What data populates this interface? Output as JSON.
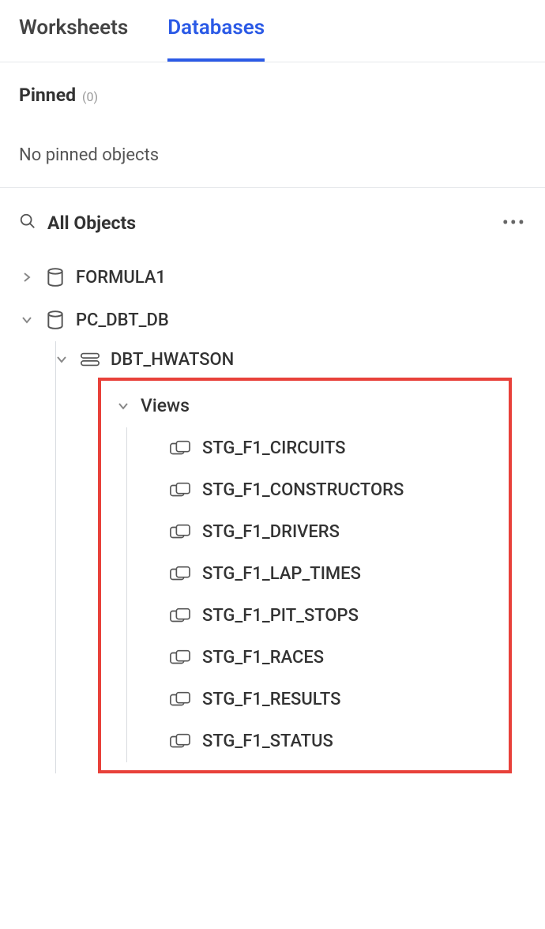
{
  "tabs": {
    "worksheets": "Worksheets",
    "databases": "Databases"
  },
  "pinned": {
    "title": "Pinned",
    "count": "(0)",
    "empty": "No pinned objects"
  },
  "objects": {
    "title": "All Objects"
  },
  "tree": {
    "db1": "FORMULA1",
    "db2": "PC_DBT_DB",
    "schema": "DBT_HWATSON",
    "views_label": "Views",
    "views": [
      "STG_F1_CIRCUITS",
      "STG_F1_CONSTRUCTORS",
      "STG_F1_DRIVERS",
      "STG_F1_LAP_TIMES",
      "STG_F1_PIT_STOPS",
      "STG_F1_RACES",
      "STG_F1_RESULTS",
      "STG_F1_STATUS"
    ]
  }
}
